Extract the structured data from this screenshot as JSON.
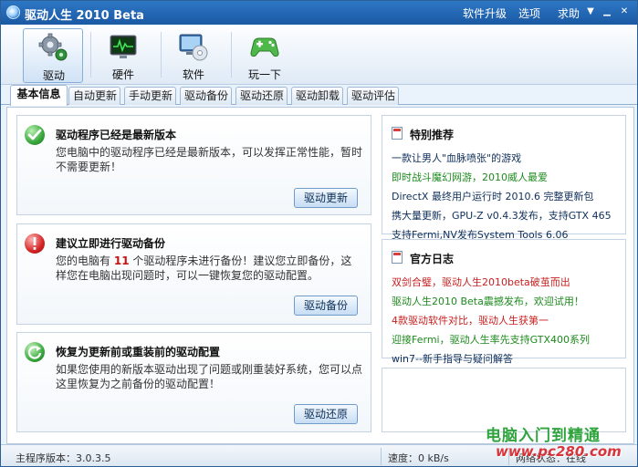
{
  "window": {
    "title": "驱动人生 2010 Beta",
    "menu": {
      "upgrade": "软件升级",
      "options": "选项",
      "help": "求助"
    }
  },
  "toolbar": {
    "items": [
      {
        "label": "驱动",
        "icon": "gears-icon",
        "active": true
      },
      {
        "label": "硬件",
        "icon": "monitor-pulse-icon"
      },
      {
        "label": "软件",
        "icon": "computer-disc-icon"
      },
      {
        "label": "玩一下",
        "icon": "gamepad-icon"
      }
    ]
  },
  "tabs": [
    "基本信息",
    "自动更新",
    "手动更新",
    "驱动备份",
    "驱动还原",
    "驱动卸载",
    "驱动评估"
  ],
  "cards": [
    {
      "title": "驱动程序已经是最新版本",
      "desc": "您电脑中的驱动程序已经是最新版本，可以发挥正常性能，暂时不需要更新！",
      "button": "驱动更新",
      "icon": "check-icon"
    },
    {
      "title": "建议立即进行驱动备份",
      "desc_prefix": "您的电脑有",
      "count": "11",
      "desc_suffix": "个驱动程序未进行备份！建议您立即备份，这样您在电脑出现问题时，可以一键恢复您的驱动配置。",
      "button": "驱动备份",
      "icon": "alert-icon"
    },
    {
      "title": "恢复为更新前或重装前的驱动配置",
      "desc": "如果您使用的新版本驱动出现了问题或刚重装好系统，您可以点这里恢复为之前备份的驱动配置！",
      "button": "驱动还原",
      "icon": "restore-icon"
    }
  ],
  "recommend": {
    "title": "特别推荐",
    "items": [
      "一款让男人\"血脉喷张\"的游戏",
      "即时战斗魔幻网游，2010威人最爱",
      "DirectX 最终用户运行时 2010.6 完整更新包",
      "携大量更新，GPU-Z v0.4.3发布，支持GTX 465",
      "支持Fermi,NV发布System Tools 6.06"
    ]
  },
  "blog": {
    "title": "官方日志",
    "items": [
      "双剑合璧，驱动人生2010beta破茧而出",
      "驱动人生2010 Beta震撼发布，欢迎试用！",
      "4款驱动软件对比，驱动人生获第一",
      "迎接Fermi，驱动人生率先支持GTX400系列",
      "win7--新手指导与疑问解答"
    ]
  },
  "colors": {
    "green": "#1d8a1d",
    "red": "#c82020",
    "blue_dark": "#0f2f5a",
    "title_bar": "#2266b8"
  },
  "status": {
    "version": "主程序版本：3.0.3.5",
    "speed": "速度：0 kB/s",
    "net": "网络状态：在线"
  },
  "watermark": {
    "line1": "电脑入门到精通",
    "line2": "www.pc280.com"
  }
}
